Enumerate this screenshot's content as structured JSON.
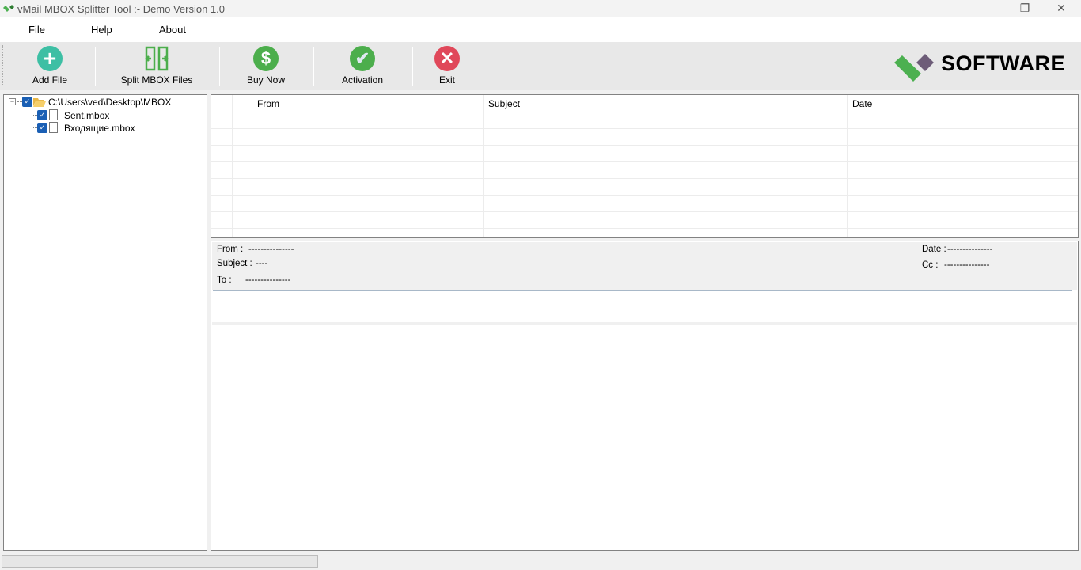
{
  "window": {
    "title": "vMail MBOX Splitter Tool  :- Demo Version 1.0",
    "minimize": "—",
    "restore": "❐",
    "close": "✕"
  },
  "menu": [
    "File",
    "Help",
    "About"
  ],
  "toolbar": {
    "add_file": "Add File",
    "split": "Split MBOX Files",
    "buy": "Buy Now",
    "activation": "Activation",
    "exit": "Exit",
    "logo_text": "SOFTWARE"
  },
  "colors": {
    "add": "#3dbfa4",
    "split": "#4cae4c",
    "buy": "#4cae4c",
    "activation": "#4cae4c",
    "exit": "#e0485a",
    "logo_green": "#4cb050",
    "logo_purple": "#6d5c78"
  },
  "tree": {
    "root": "C:\\Users\\ved\\Desktop\\MBOX",
    "children": [
      "Sent.mbox",
      "Входящие.mbox"
    ],
    "checked": true
  },
  "grid": {
    "columns": [
      "",
      "",
      "From",
      "Subject",
      "Date"
    ]
  },
  "preview": {
    "from_label": "From :",
    "from_value": "---------------",
    "subject_label": "Subject :",
    "subject_value": "----",
    "to_label": "To :",
    "to_value": "---------------",
    "date_label": "Date :",
    "date_value": "---------------",
    "cc_label": "Cc :",
    "cc_value": "---------------"
  },
  "status": {
    "progress": 0
  }
}
